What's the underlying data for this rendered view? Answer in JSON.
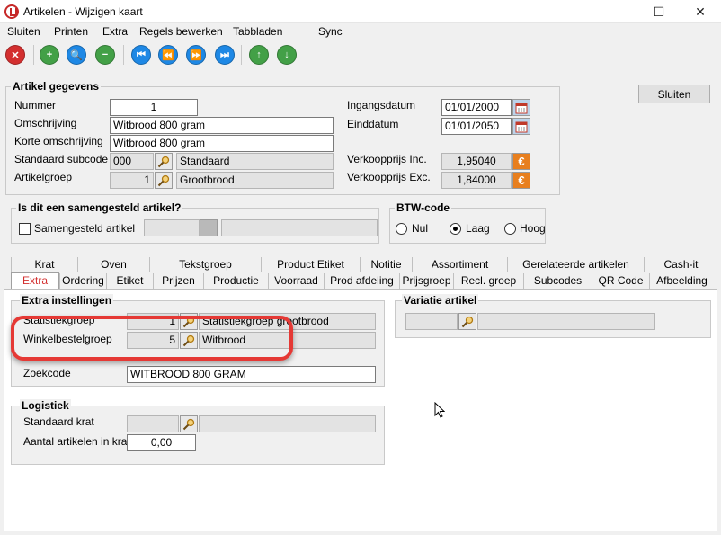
{
  "window": {
    "title": "Artikelen - Wijzigen kaart",
    "min_glyph": "—",
    "max_glyph": "☐",
    "close_glyph": "✕"
  },
  "menu": [
    "Sluiten",
    "Printen",
    "Extra",
    "Regels bewerken",
    "Tabbladen",
    "Sync"
  ],
  "toolbar": [
    {
      "name": "delete",
      "icon": "cross-icon",
      "glyph": "✕",
      "color": "#d32f2f"
    },
    {
      "name": "add",
      "icon": "plus-icon",
      "glyph": "+",
      "color": "#43a047"
    },
    {
      "name": "search",
      "icon": "magnifier-icon",
      "glyph": "🔍",
      "color": "#1e88e5"
    },
    {
      "name": "remove",
      "icon": "minus-icon",
      "glyph": "−",
      "color": "#43a047"
    },
    {
      "name": "first",
      "icon": "first-record-icon",
      "glyph": "⏮",
      "color": "#1e88e5"
    },
    {
      "name": "prev",
      "icon": "previous-record-icon",
      "glyph": "⏪",
      "color": "#1e88e5"
    },
    {
      "name": "next",
      "icon": "next-record-icon",
      "glyph": "⏩",
      "color": "#1e88e5"
    },
    {
      "name": "last",
      "icon": "last-record-icon",
      "glyph": "⏭",
      "color": "#1e88e5"
    },
    {
      "name": "up",
      "icon": "arrow-up-icon",
      "glyph": "↑",
      "color": "#43a047"
    },
    {
      "name": "down",
      "icon": "arrow-down-icon",
      "glyph": "↓",
      "color": "#43a047"
    }
  ],
  "article": {
    "title": "Artikel gegevens",
    "nummer_label": "Nummer",
    "nummer": "1",
    "omschrijving_label": "Omschrijving",
    "omschrijving": "Witbrood 800 gram",
    "korte_label": "Korte omschrijving",
    "korte": "Witbrood 800 gram",
    "subcode_label": "Standaard subcode",
    "subcode": "000",
    "subcode_text": "Standaard",
    "groep_label": "Artikelgroep",
    "groep": "1",
    "groep_text": "Grootbrood",
    "ingang_label": "Ingangsdatum",
    "ingang": "01/01/2000",
    "eind_label": "Einddatum",
    "eind": "01/01/2050",
    "vk_inc_label": "Verkoopprijs Inc.",
    "vk_inc": "1,95040",
    "vk_exc_label": "Verkoopprijs Exc.",
    "vk_exc": "1,84000",
    "currency_glyph": "€"
  },
  "sluiten_button": "Sluiten",
  "samengesteld": {
    "title": "Is dit een samengesteld artikel?",
    "checkbox_label": "Samengesteld artikel"
  },
  "btw": {
    "title": "BTW-code",
    "options": [
      "Nul",
      "Laag",
      "Hoog"
    ],
    "selected": "Laag"
  },
  "tabs_row1": [
    "Krat",
    "Oven",
    "Tekstgroep",
    "Product Etiket",
    "Notitie",
    "Assortiment",
    "Gerelateerde artikelen",
    "Cash-it"
  ],
  "tabs_row2": [
    "Extra",
    "Ordering",
    "Etiket",
    "Prijzen",
    "Productie",
    "Voorraad",
    "Prod afdeling",
    "Prijsgroep",
    "Recl. groep",
    "Subcodes",
    "QR Code",
    "Afbeelding"
  ],
  "active_tab": "Extra",
  "extra": {
    "title": "Extra instellingen",
    "statistiek_label": "Statistiekgroep",
    "statistiek": "1",
    "statistiek_text": "Statistiekgroep grootbrood",
    "winkel_label": "Winkelbestelgroep",
    "winkel": "5",
    "winkel_text": "Witbrood",
    "zoek_label": "Zoekcode",
    "zoek": "WITBROOD 800 GRAM"
  },
  "logistiek": {
    "title": "Logistiek",
    "krat_label": "Standaard krat",
    "aantal_label": "Aantal artikelen in krat",
    "aantal": "0,00"
  },
  "variatie": {
    "title": "Variatie artikel"
  }
}
